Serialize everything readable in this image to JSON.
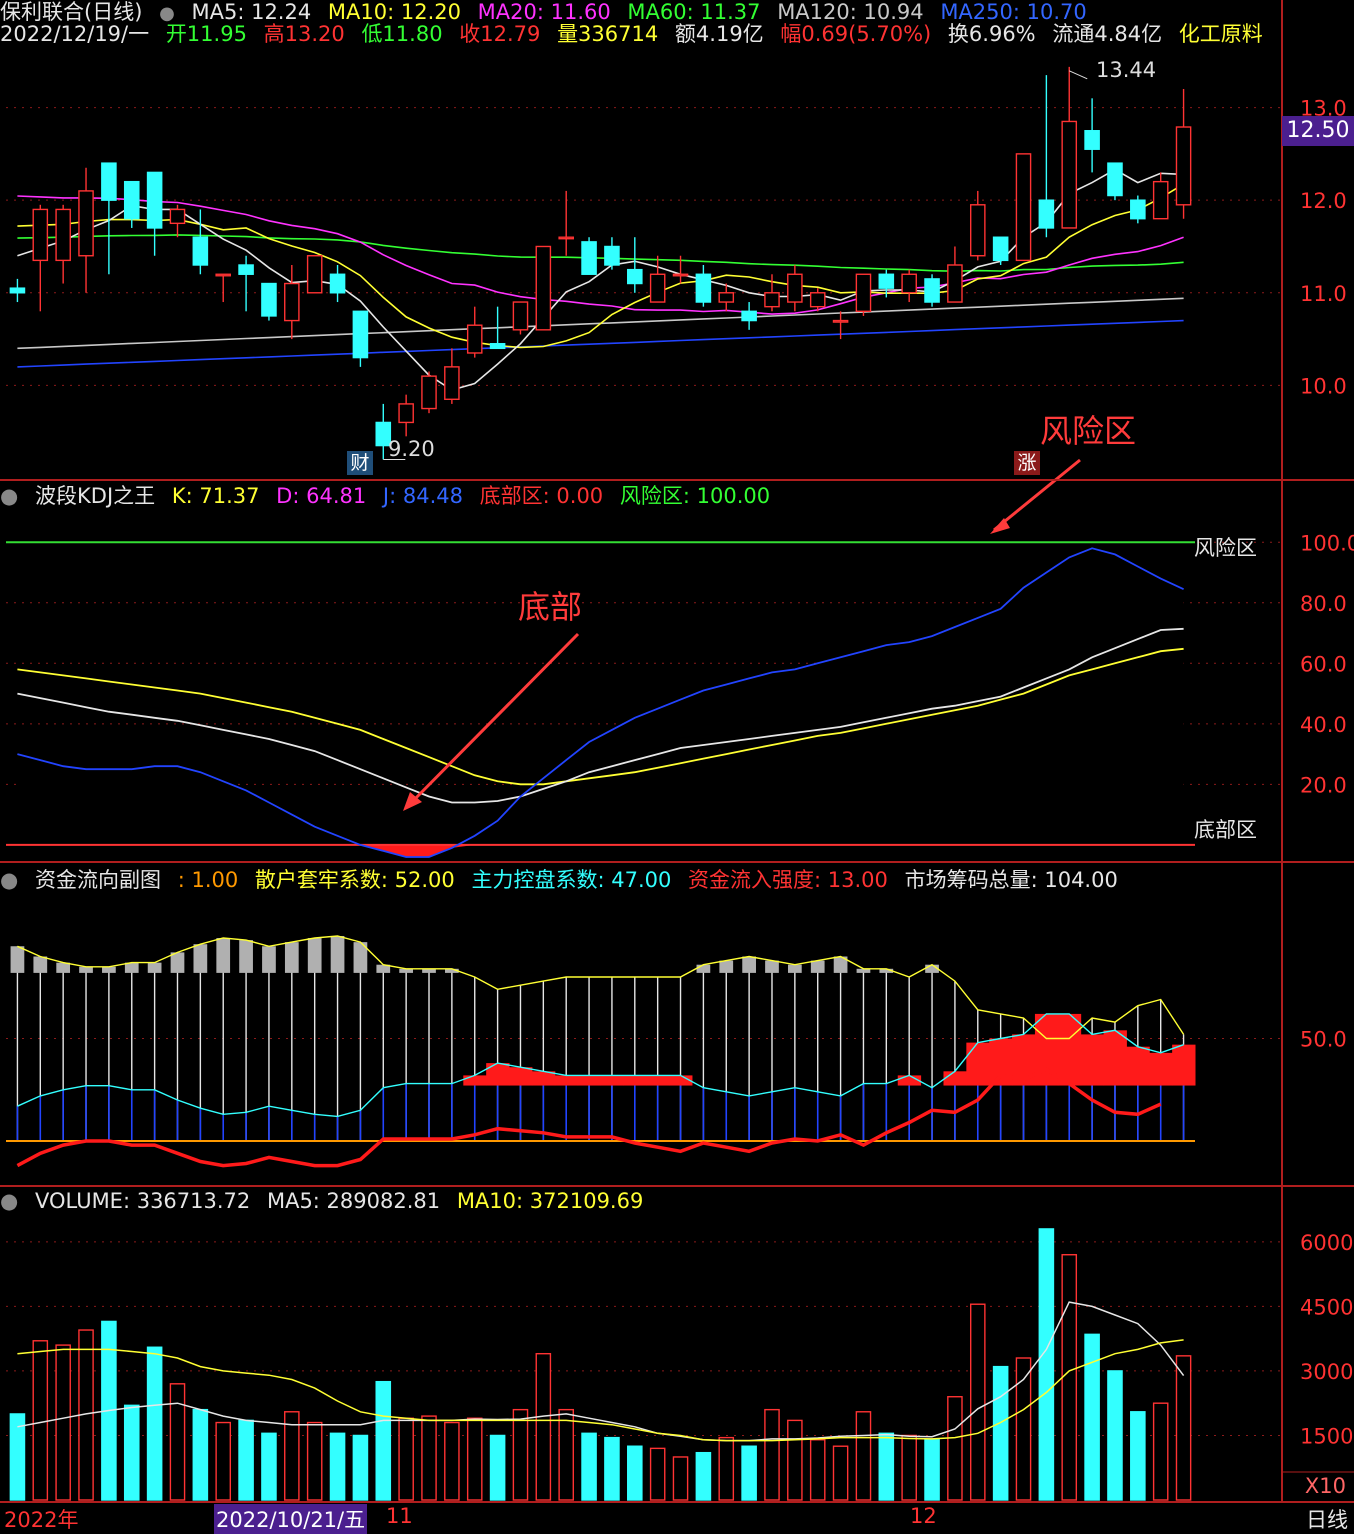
{
  "header1": {
    "stock": "保利联合(日线)",
    "ma5": "MA5: 12.24",
    "ma10": "MA10: 12.20",
    "ma20": "MA20: 11.60",
    "ma60": "MA60: 11.37",
    "ma120": "MA120: 10.94",
    "ma250": "MA250: 10.70"
  },
  "header2": {
    "date": "2022/12/19/一",
    "open": "开11.95",
    "high": "高13.20",
    "low": "低11.80",
    "close": "收12.79",
    "vol": "量336714",
    "amt": "额4.19亿",
    "chg": "幅0.69(5.70%)",
    "turn": "换6.96%",
    "float": "流通4.84亿",
    "sector": "化工原料"
  },
  "kdj": {
    "title": "波段KDJ之王",
    "k": "K: 71.37",
    "d": "D: 64.81",
    "j": "J: 84.48",
    "bottom": "底部区: 0.00",
    "risk": "风险区: 100.00",
    "risk_line_label": "风险区",
    "bottom_line_label": "底部区"
  },
  "fund": {
    "title": "资金流向副图",
    "c1": ": 1.00",
    "c2": "散户套牢系数: 52.00",
    "c3": "主力控盘系数: 47.00",
    "c4": "资金流入强度: 13.00",
    "c5": "市场筹码总量: 104.00"
  },
  "vol": {
    "title": "VOLUME: 336713.72",
    "ma5": "MA5: 289082.81",
    "ma10": "MA10: 372109.69",
    "unit": "X10"
  },
  "annotations": {
    "risk": "风险区",
    "bottom": "底部"
  },
  "markers": {
    "high": "13.44",
    "low": "9.20",
    "cai": "财",
    "zhang": "涨"
  },
  "current_price": "12.50",
  "dates": {
    "year": "2022年",
    "cursor": "2022/10/21/五",
    "m11": "11",
    "m12": "12",
    "period": "日线"
  },
  "colors": {
    "up": "#ff3333",
    "down": "#33ffff",
    "ma5": "#e6e6e6",
    "ma10": "#ffff33",
    "ma20": "#ff33ff",
    "ma60": "#33ff33",
    "ma120": "#c8c8c8",
    "ma250": "#2244ff"
  },
  "chart_data": [
    {
      "type": "candlestick",
      "title": "保利联合(日线)",
      "ylim": [
        9.0,
        13.6
      ],
      "yticks": [
        10.0,
        11.0,
        12.0,
        13.0
      ],
      "candles": [
        [
          11.05,
          11.0,
          11.15,
          10.9
        ],
        [
          11.35,
          11.9,
          11.95,
          10.8
        ],
        [
          11.35,
          11.9,
          11.95,
          11.1
        ],
        [
          11.4,
          12.1,
          12.35,
          11.0
        ],
        [
          12.4,
          12.0,
          12.4,
          11.2
        ],
        [
          12.2,
          11.8,
          11.9,
          11.7
        ],
        [
          12.3,
          11.7,
          12.3,
          11.4
        ],
        [
          11.75,
          11.9,
          11.95,
          11.6
        ],
        [
          11.6,
          11.3,
          11.9,
          11.2
        ],
        [
          11.2,
          11.2,
          11.2,
          10.9
        ],
        [
          11.3,
          11.2,
          11.4,
          10.8
        ],
        [
          11.1,
          10.75,
          11.1,
          10.7
        ],
        [
          10.7,
          11.1,
          11.3,
          10.5
        ],
        [
          11.0,
          11.4,
          11.4,
          11.0
        ],
        [
          11.2,
          11.0,
          11.3,
          10.9
        ],
        [
          10.8,
          10.3,
          10.8,
          10.2
        ],
        [
          9.6,
          9.35,
          9.8,
          9.2
        ],
        [
          9.6,
          9.8,
          9.9,
          9.45
        ],
        [
          9.75,
          10.1,
          10.15,
          9.7
        ],
        [
          9.85,
          10.2,
          10.4,
          9.8
        ],
        [
          10.35,
          10.65,
          10.85,
          10.3
        ],
        [
          10.45,
          10.4,
          10.85,
          10.4
        ],
        [
          10.6,
          10.9,
          10.9,
          10.55
        ],
        [
          10.6,
          11.5,
          11.5,
          10.6
        ],
        [
          11.6,
          11.6,
          12.1,
          11.4
        ],
        [
          11.55,
          11.2,
          11.6,
          11.2
        ],
        [
          11.5,
          11.3,
          11.6,
          11.25
        ],
        [
          11.25,
          11.1,
          11.6,
          11.0
        ],
        [
          10.9,
          11.2,
          11.4,
          10.9
        ],
        [
          11.2,
          11.2,
          11.4,
          11.1
        ],
        [
          11.2,
          10.9,
          11.3,
          10.85
        ],
        [
          10.9,
          11.0,
          11.1,
          10.8
        ],
        [
          10.8,
          10.7,
          10.9,
          10.6
        ],
        [
          10.85,
          11.0,
          11.2,
          10.8
        ],
        [
          10.9,
          11.2,
          11.3,
          10.8
        ],
        [
          10.85,
          11.0,
          11.05,
          10.8
        ],
        [
          10.7,
          10.7,
          10.8,
          10.5
        ],
        [
          10.8,
          11.2,
          11.2,
          10.75
        ],
        [
          11.2,
          11.05,
          11.25,
          10.95
        ],
        [
          11.0,
          11.2,
          11.25,
          10.9
        ],
        [
          11.15,
          10.9,
          11.2,
          10.85
        ],
        [
          10.9,
          11.3,
          11.5,
          10.9
        ],
        [
          11.4,
          11.95,
          12.1,
          11.35
        ],
        [
          11.6,
          11.35,
          11.6,
          11.3
        ],
        [
          11.35,
          12.5,
          12.5,
          11.35
        ],
        [
          12.0,
          11.7,
          13.35,
          11.6
        ],
        [
          11.7,
          12.85,
          13.44,
          11.7
        ],
        [
          12.75,
          12.55,
          13.1,
          12.3
        ],
        [
          12.4,
          12.05,
          12.4,
          12.0
        ],
        [
          12.0,
          11.8,
          12.05,
          11.75
        ],
        [
          11.8,
          12.2,
          12.3,
          11.8
        ],
        [
          11.95,
          12.79,
          13.2,
          11.8
        ]
      ],
      "high_label": "13.44",
      "low_label": "9.20"
    },
    {
      "type": "line",
      "title": "波段KDJ之王",
      "ylim": [
        -5,
        110
      ],
      "yticks": [
        20,
        40,
        60,
        80,
        100
      ],
      "risk_level": 100,
      "bottom_level": 0,
      "series": [
        {
          "name": "K",
          "values": [
            50,
            48.5,
            47,
            45.5,
            44,
            43,
            42,
            41,
            39.5,
            38,
            36.5,
            35,
            33,
            31,
            28,
            25,
            22,
            19,
            16,
            14,
            14,
            14.5,
            16,
            18.5,
            21,
            24,
            26,
            28,
            30,
            32,
            33,
            34,
            35,
            36,
            37,
            38,
            39,
            40.5,
            42,
            43.5,
            45,
            46,
            47.5,
            49,
            52,
            55,
            58,
            62,
            65,
            68,
            71,
            71.4
          ]
        },
        {
          "name": "D",
          "values": [
            58,
            57,
            56,
            55,
            54,
            53,
            52,
            51,
            50,
            48.5,
            47,
            45.5,
            44,
            42,
            40,
            38,
            35,
            32,
            29,
            26,
            23,
            21,
            20,
            20,
            21,
            22,
            23,
            24,
            25.5,
            27,
            28.5,
            30,
            31.5,
            33,
            34.5,
            36,
            37,
            38.5,
            40,
            41.5,
            43,
            44.5,
            46,
            48,
            50,
            53,
            56,
            58,
            60,
            62,
            64,
            64.8
          ]
        },
        {
          "name": "J",
          "values": [
            30,
            28,
            26,
            25,
            25,
            25,
            26,
            26,
            24,
            21,
            18,
            14,
            10,
            6,
            3,
            0,
            -2,
            -4,
            -4,
            -1,
            3,
            8,
            16,
            22,
            28,
            34,
            38,
            42,
            45,
            48,
            51,
            53,
            55,
            57,
            58,
            60,
            62,
            64,
            66,
            67,
            69,
            72,
            75,
            78,
            85,
            90,
            95,
            98,
            96,
            92,
            88,
            84.5
          ]
        }
      ]
    },
    {
      "type": "bar",
      "title": "资金流向副图",
      "ylim": [
        -20,
        120
      ],
      "yticks": [
        50
      ],
      "series": [
        {
          "name": "散户套牢系数",
          "values": [
            95,
            90,
            87,
            85,
            85,
            87,
            87,
            92,
            96,
            99,
            98,
            95,
            97,
            99,
            100,
            97,
            86,
            84,
            84,
            84,
            80,
            74,
            76,
            78,
            80,
            80,
            80,
            80,
            80,
            80,
            86,
            88,
            90,
            88,
            86,
            88,
            90,
            84,
            84,
            80,
            86,
            78,
            64,
            62,
            60,
            50,
            50,
            60,
            58,
            66,
            69,
            52
          ]
        },
        {
          "name": "主力控盘系数",
          "values": [
            17,
            22,
            25,
            27,
            27,
            25,
            25,
            20,
            16,
            13,
            14,
            17,
            15,
            13,
            12,
            15,
            26,
            28,
            28,
            28,
            32,
            38,
            36,
            34,
            32,
            32,
            32,
            32,
            32,
            32,
            26,
            24,
            22,
            24,
            26,
            24,
            22,
            28,
            28,
            32,
            26,
            34,
            48,
            50,
            52,
            62,
            62,
            52,
            54,
            46,
            43,
            47
          ]
        },
        {
          "name": "资金流入强度",
          "values": [
            -12,
            -6,
            -2,
            0,
            0,
            -2,
            -2,
            -6,
            -10,
            -12,
            -11,
            -8,
            -10,
            -12,
            -12,
            -9,
            1,
            1,
            1,
            1,
            3,
            6,
            5,
            4,
            2,
            2,
            2,
            -1,
            -3,
            -5,
            -1,
            -3,
            -5,
            -1,
            1,
            0,
            3,
            -2,
            4,
            9,
            15,
            14,
            20,
            32,
            30,
            35,
            28,
            20,
            14,
            13,
            18
          ]
        }
      ]
    },
    {
      "type": "bar",
      "title": "VOLUME",
      "ylim": [
        0,
        6600
      ],
      "yticks": [
        1500,
        3000,
        4500,
        6000
      ],
      "values": [
        2000,
        3700,
        3600,
        3950,
        4150,
        2200,
        3550,
        2700,
        2100,
        1800,
        1850,
        1550,
        2050,
        1800,
        1550,
        1500,
        2750,
        1900,
        1950,
        1800,
        1900,
        1500,
        2100,
        3400,
        2100,
        1550,
        1450,
        1250,
        1200,
        1000,
        1100,
        1450,
        1250,
        2100,
        1850,
        1400,
        1250,
        2050,
        1550,
        1500,
        1400,
        2400,
        4550,
        3100,
        3300,
        6300,
        5700,
        3850,
        3000,
        2050,
        2250,
        3350
      ],
      "ma5": [
        1700,
        1800,
        1900,
        2000,
        2080,
        2150,
        2200,
        2250,
        2100,
        1950,
        1850,
        1800,
        1750,
        1750,
        1750,
        1750,
        1850,
        1850,
        1850,
        1850,
        1880,
        1870,
        1880,
        1950,
        2000,
        1900,
        1800,
        1700,
        1550,
        1480,
        1400,
        1380,
        1380,
        1420,
        1420,
        1440,
        1480,
        1500,
        1520,
        1480,
        1470,
        1650,
        2120,
        2400,
        2800,
        3500,
        4600,
        4500,
        4300,
        4100,
        3600,
        2890
      ],
      "ma10": [
        3400,
        3450,
        3500,
        3500,
        3500,
        3450,
        3400,
        3300,
        3100,
        3000,
        2950,
        2900,
        2800,
        2600,
        2300,
        2050,
        1950,
        1900,
        1850,
        1850,
        1850,
        1850,
        1850,
        1850,
        1850,
        1800,
        1750,
        1650,
        1550,
        1500,
        1400,
        1380,
        1380,
        1380,
        1400,
        1420,
        1450,
        1450,
        1450,
        1430,
        1420,
        1450,
        1550,
        1800,
        2100,
        2500,
        3000,
        3200,
        3400,
        3500,
        3650,
        3721
      ]
    }
  ]
}
